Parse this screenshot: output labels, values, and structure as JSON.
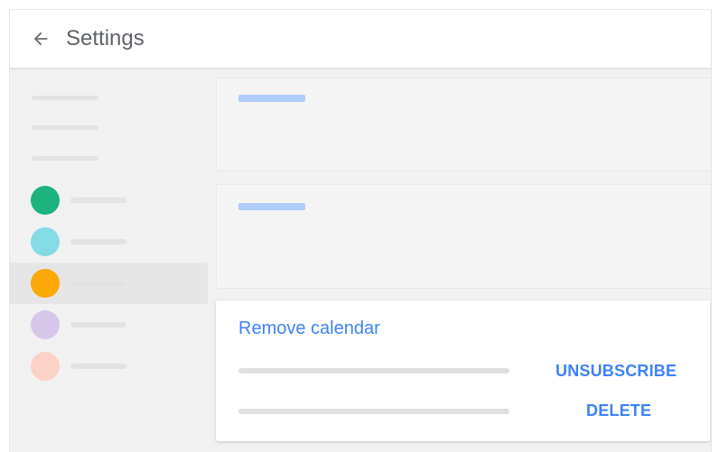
{
  "appbar": {
    "title": "Settings",
    "back_icon": "arrow-left-icon"
  },
  "sidebar": {
    "calendars": [
      {
        "color": "#1db37e",
        "selected": false
      },
      {
        "color": "#84dbe6",
        "selected": false
      },
      {
        "color": "#fba808",
        "selected": true
      },
      {
        "color": "#d6c7ea",
        "selected": false
      },
      {
        "color": "#fcd2c6",
        "selected": false
      }
    ]
  },
  "remove_card": {
    "title": "Remove calendar",
    "unsubscribe_label": "UNSUBSCRIBE",
    "delete_label": "DELETE"
  },
  "colors": {
    "accent": "#3e82f7",
    "placeholder_blue": "#aecbfa",
    "placeholder_gray": "#e0e0e0"
  }
}
